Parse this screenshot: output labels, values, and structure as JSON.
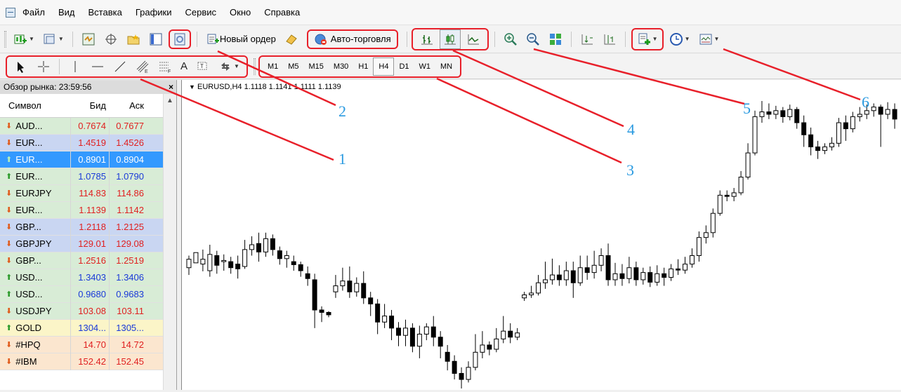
{
  "menu": [
    "Файл",
    "Вид",
    "Вставка",
    "Графики",
    "Сервис",
    "Окно",
    "Справка"
  ],
  "toolbar1": {
    "new_order_label": "Новый ордер",
    "auto_trading_label": "Авто-торговля"
  },
  "toolbar2": {
    "text_tool_label": "A",
    "timeframes": [
      "M1",
      "M5",
      "M15",
      "M30",
      "H1",
      "H4",
      "D1",
      "W1",
      "MN"
    ],
    "active_timeframe": "H4"
  },
  "callouts": [
    "1",
    "2",
    "3",
    "4",
    "5",
    "6"
  ],
  "market_watch": {
    "title": "Обзор рынка: 23:59:56",
    "close_label": "×",
    "headers": {
      "symbol": "Символ",
      "bid": "Бид",
      "ask": "Аск"
    },
    "rows": [
      {
        "symbol": "AUD...",
        "bid": "0.7674",
        "ask": "0.7677",
        "dir": "down",
        "bg": "#d8ecd6",
        "color": "#e02020"
      },
      {
        "symbol": "EUR...",
        "bid": "1.4519",
        "ask": "1.4526",
        "dir": "down",
        "bg": "#c9d6f2",
        "color": "#e02020"
      },
      {
        "symbol": "EUR...",
        "bid": "0.8901",
        "ask": "0.8904",
        "dir": "up",
        "bg": "#3399ff",
        "color": "#ffffff",
        "selected": true
      },
      {
        "symbol": "EUR...",
        "bid": "1.0785",
        "ask": "1.0790",
        "dir": "up",
        "bg": "#d8ecd6",
        "color": "#1a3ad8"
      },
      {
        "symbol": "EURJPY",
        "bid": "114.83",
        "ask": "114.86",
        "dir": "down",
        "bg": "#d8ecd6",
        "color": "#e02020"
      },
      {
        "symbol": "EUR...",
        "bid": "1.1139",
        "ask": "1.1142",
        "dir": "down",
        "bg": "#d8ecd6",
        "color": "#e02020"
      },
      {
        "symbol": "GBP...",
        "bid": "1.2118",
        "ask": "1.2125",
        "dir": "down",
        "bg": "#c9d6f2",
        "color": "#e02020"
      },
      {
        "symbol": "GBPJPY",
        "bid": "129.01",
        "ask": "129.08",
        "dir": "down",
        "bg": "#c9d6f2",
        "color": "#e02020"
      },
      {
        "symbol": "GBP...",
        "bid": "1.2516",
        "ask": "1.2519",
        "dir": "down",
        "bg": "#d8ecd6",
        "color": "#e02020"
      },
      {
        "symbol": "USD...",
        "bid": "1.3403",
        "ask": "1.3406",
        "dir": "up",
        "bg": "#d8ecd6",
        "color": "#1a3ad8"
      },
      {
        "symbol": "USD...",
        "bid": "0.9680",
        "ask": "0.9683",
        "dir": "up",
        "bg": "#d8ecd6",
        "color": "#1a3ad8"
      },
      {
        "symbol": "USDJPY",
        "bid": "103.08",
        "ask": "103.11",
        "dir": "down",
        "bg": "#d8ecd6",
        "color": "#e02020"
      },
      {
        "symbol": "GOLD",
        "bid": "1304...",
        "ask": "1305...",
        "dir": "up",
        "bg": "#fbf5c8",
        "color": "#1a3ad8"
      },
      {
        "symbol": "#HPQ",
        "bid": "14.70",
        "ask": "14.72",
        "dir": "down",
        "bg": "#fbe6cf",
        "color": "#e02020"
      },
      {
        "symbol": "#IBM",
        "bid": "152.42",
        "ask": "152.45",
        "dir": "down",
        "bg": "#fbe6cf",
        "color": "#e02020"
      }
    ]
  },
  "chart": {
    "label": "EURUSD,H4  1.1118 1.1141 1.1111 1.1139",
    "candles": [
      [
        1.109,
        1.1104,
        1.1078,
        1.111
      ],
      [
        1.1098,
        1.1115,
        1.1092,
        1.1092
      ],
      [
        1.1096,
        1.1104,
        1.1084,
        1.112
      ],
      [
        1.1085,
        1.1112,
        1.1075,
        1.1128
      ],
      [
        1.111,
        1.1094,
        1.108,
        1.1118
      ],
      [
        1.11,
        1.1102,
        1.1085,
        1.1112
      ],
      [
        1.11,
        1.109,
        1.108,
        1.1108
      ],
      [
        1.1096,
        1.1088,
        1.1072,
        1.111
      ],
      [
        1.1092,
        1.112,
        1.1088,
        1.1136
      ],
      [
        1.112,
        1.1128,
        1.111,
        1.1142
      ],
      [
        1.113,
        1.1116,
        1.11,
        1.1148
      ],
      [
        1.1116,
        1.1138,
        1.1108,
        1.1148
      ],
      [
        1.1138,
        1.112,
        1.111,
        1.1145
      ],
      [
        1.1118,
        1.1105,
        1.1095,
        1.1125
      ],
      [
        1.1105,
        1.111,
        1.109,
        1.1118
      ],
      [
        1.11,
        1.1095,
        1.1085,
        1.111
      ],
      [
        1.1095,
        1.1085,
        1.1075,
        1.11
      ],
      [
        1.108,
        1.1072,
        1.106,
        1.1092
      ],
      [
        1.107,
        1.102,
        1.099,
        1.108
      ],
      [
        1.102,
        1.1016,
        1.1,
        1.1026
      ],
      [
        1.1016,
        1.1012,
        1.1008,
        1.1018
      ],
      [
        1.105,
        1.106,
        1.104,
        1.1078
      ],
      [
        1.106,
        1.1068,
        1.1052,
        1.109
      ],
      [
        1.1068,
        1.105,
        1.104,
        1.1092
      ],
      [
        1.105,
        1.1064,
        1.1042,
        1.1074
      ],
      [
        1.1064,
        1.104,
        1.103,
        1.1084
      ],
      [
        1.104,
        1.103,
        1.101,
        1.105
      ],
      [
        1.103,
        1.1,
        1.098,
        1.1038
      ],
      [
        1.1,
        1.101,
        1.099,
        1.103
      ],
      [
        1.101,
        1.099,
        1.097,
        1.102
      ],
      [
        1.099,
        1.0978,
        1.096,
        1.1
      ],
      [
        1.0978,
        1.099,
        1.096,
        1.1004
      ],
      [
        1.099,
        1.096,
        1.095,
        1.0998
      ],
      [
        1.096,
        1.098,
        1.094,
        1.0994
      ],
      [
        1.098,
        1.0992,
        1.097,
        1.0998
      ],
      [
        1.0992,
        1.0975,
        1.096,
        1.101
      ],
      [
        1.0975,
        1.096,
        1.094,
        1.0985
      ],
      [
        1.095,
        1.0935,
        1.092,
        1.0962
      ],
      [
        1.0935,
        1.0915,
        1.0905,
        1.0945
      ],
      [
        1.0915,
        1.0905,
        1.089,
        1.0925
      ],
      [
        1.0905,
        1.0925,
        1.09,
        1.0935
      ],
      [
        1.0925,
        1.095,
        1.092,
        1.098
      ],
      [
        1.095,
        1.0962,
        1.094,
        1.0985
      ],
      [
        1.0962,
        1.0955,
        1.0945,
        1.0968
      ],
      [
        1.0955,
        1.0972,
        1.095,
        1.099
      ],
      [
        1.0972,
        1.0985,
        1.0965,
        1.101
      ],
      [
        1.0985,
        1.0975,
        1.0965,
        1.0998
      ],
      [
        1.0975,
        1.0982,
        1.097,
        1.099
      ],
      [
        1.104,
        1.1045,
        1.1035,
        1.105
      ],
      [
        1.1045,
        1.1048,
        1.104,
        1.106
      ],
      [
        1.1048,
        1.1065,
        1.1044,
        1.1078
      ],
      [
        1.1065,
        1.107,
        1.1055,
        1.11
      ],
      [
        1.107,
        1.1078,
        1.1062,
        1.1105
      ],
      [
        1.1078,
        1.107,
        1.106,
        1.1094
      ],
      [
        1.107,
        1.1085,
        1.106,
        1.11
      ],
      [
        1.1085,
        1.1065,
        1.104,
        1.11
      ],
      [
        1.1065,
        1.109,
        1.106,
        1.111
      ],
      [
        1.109,
        1.1082,
        1.107,
        1.111
      ],
      [
        1.1082,
        1.1094,
        1.1072,
        1.1118
      ],
      [
        1.1094,
        1.111,
        1.1084,
        1.1122
      ],
      [
        1.111,
        1.107,
        1.106,
        1.113
      ],
      [
        1.107,
        1.108,
        1.106,
        1.1098
      ],
      [
        1.108,
        1.1072,
        1.106,
        1.1096
      ],
      [
        1.1072,
        1.109,
        1.1064,
        1.1108
      ],
      [
        1.109,
        1.107,
        1.106,
        1.11
      ],
      [
        1.107,
        1.1082,
        1.1062,
        1.109
      ],
      [
        1.1082,
        1.1066,
        1.1058,
        1.1092
      ],
      [
        1.1066,
        1.108,
        1.106,
        1.1094
      ],
      [
        1.108,
        1.1074,
        1.106,
        1.109
      ],
      [
        1.1074,
        1.1088,
        1.1068,
        1.1096
      ],
      [
        1.1088,
        1.1086,
        1.1078,
        1.1104
      ],
      [
        1.1086,
        1.1096,
        1.108,
        1.1108
      ],
      [
        1.1096,
        1.111,
        1.109,
        1.1122
      ],
      [
        1.111,
        1.114,
        1.11,
        1.115
      ],
      [
        1.114,
        1.1148,
        1.113,
        1.116
      ],
      [
        1.1148,
        1.118,
        1.114,
        1.1188
      ],
      [
        1.118,
        1.121,
        1.1176,
        1.1218
      ],
      [
        1.121,
        1.1208,
        1.12,
        1.1218
      ],
      [
        1.1208,
        1.1214,
        1.12,
        1.1222
      ],
      [
        1.1214,
        1.124,
        1.121,
        1.125
      ],
      [
        1.124,
        1.128,
        1.1236,
        1.1296
      ],
      [
        1.128,
        1.134,
        1.1276,
        1.135
      ],
      [
        1.134,
        1.1348,
        1.133,
        1.1366
      ],
      [
        1.1348,
        1.1344,
        1.1336,
        1.1362
      ],
      [
        1.1344,
        1.135,
        1.1336,
        1.1358
      ],
      [
        1.135,
        1.134,
        1.133,
        1.1356
      ],
      [
        1.134,
        1.1352,
        1.1334,
        1.136
      ],
      [
        1.1352,
        1.133,
        1.132,
        1.1356
      ],
      [
        1.133,
        1.131,
        1.129,
        1.1342
      ],
      [
        1.131,
        1.129,
        1.1276,
        1.1322
      ],
      [
        1.129,
        1.1284,
        1.127,
        1.13
      ],
      [
        1.1284,
        1.129,
        1.1278,
        1.1296
      ],
      [
        1.129,
        1.1296,
        1.1284,
        1.1306
      ],
      [
        1.1296,
        1.133,
        1.129,
        1.1338
      ],
      [
        1.133,
        1.132,
        1.13,
        1.1342
      ],
      [
        1.132,
        1.134,
        1.1314,
        1.1348
      ],
      [
        1.134,
        1.1344,
        1.1332,
        1.1356
      ],
      [
        1.1344,
        1.135,
        1.1336,
        1.136
      ],
      [
        1.135,
        1.1356,
        1.134,
        1.1362
      ],
      [
        1.1356,
        1.1344,
        1.129,
        1.136
      ],
      [
        1.1344,
        1.1352,
        1.1336,
        1.1364
      ],
      [
        1.1352,
        1.1336,
        1.132,
        1.1362
      ]
    ]
  }
}
